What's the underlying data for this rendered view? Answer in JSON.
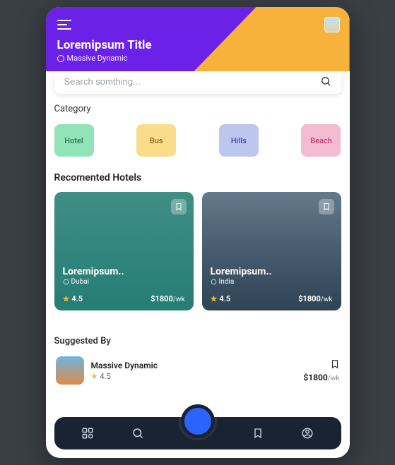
{
  "header": {
    "title": "Loremipsum Title",
    "subtitle": "Massive Dynamic"
  },
  "search": {
    "placeholder": "Search somthing..."
  },
  "category": {
    "label": "Category",
    "items": [
      "Hotel",
      "Bus",
      "Hills",
      "Beach"
    ]
  },
  "recommended": {
    "label": "Recomented Hotels",
    "cards": [
      {
        "title": "Loremipsum..",
        "location": "Dubai",
        "rating": "4.5",
        "price": "$1800",
        "unit": "/wk"
      },
      {
        "title": "Loremipsum..",
        "location": "India",
        "rating": "4.5",
        "price": "$1800",
        "unit": "/wk"
      }
    ]
  },
  "suggested": {
    "label": "Suggested By",
    "item": {
      "name": "Massive Dynamic",
      "rating": "4.5",
      "price": "$1800",
      "unit": "/wk"
    }
  }
}
